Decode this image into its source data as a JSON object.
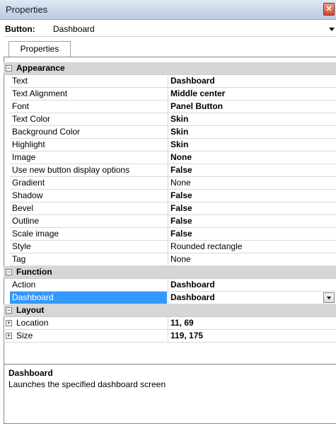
{
  "window": {
    "title": "Properties",
    "close_glyph": "✕"
  },
  "object_selector": {
    "label": "Button:",
    "value": "Dashboard"
  },
  "tabs": [
    {
      "label": "Properties"
    }
  ],
  "categories": {
    "appearance": {
      "label": "Appearance",
      "toggle": "−",
      "rows": [
        {
          "name": "Text",
          "value": "Dashboard",
          "bold": true
        },
        {
          "name": "Text Alignment",
          "value": "Middle center",
          "bold": true
        },
        {
          "name": "Font",
          "value": "Panel Button",
          "bold": true
        },
        {
          "name": "Text Color",
          "value": "Skin",
          "bold": true
        },
        {
          "name": "Background Color",
          "value": "Skin",
          "bold": true
        },
        {
          "name": "Highlight",
          "value": "Skin",
          "bold": true
        },
        {
          "name": "Image",
          "value": "None",
          "bold": true
        },
        {
          "name": "Use new button display options",
          "value": "False",
          "bold": true
        },
        {
          "name": "Gradient",
          "value": "None",
          "bold": false
        },
        {
          "name": "Shadow",
          "value": "False",
          "bold": true
        },
        {
          "name": "Bevel",
          "value": "False",
          "bold": true
        },
        {
          "name": "Outline",
          "value": "False",
          "bold": true
        },
        {
          "name": "Scale image",
          "value": "False",
          "bold": true
        },
        {
          "name": "Style",
          "value": "Rounded rectangle",
          "bold": false
        },
        {
          "name": "Tag",
          "value": "None",
          "bold": false
        }
      ]
    },
    "function": {
      "label": "Function",
      "toggle": "−",
      "rows": [
        {
          "name": "Action",
          "value": "Dashboard",
          "bold": true
        },
        {
          "name": "Dashboard",
          "value": "Dashboard",
          "bold": true,
          "selected": true
        }
      ]
    },
    "layout": {
      "label": "Layout",
      "toggle": "−",
      "rows": [
        {
          "name": "Location",
          "value": "11, 69",
          "toggle": "+"
        },
        {
          "name": "Size",
          "value": "119, 175",
          "toggle": "+"
        }
      ]
    }
  },
  "description": {
    "title": "Dashboard",
    "text": "Launches the specified dashboard screen"
  },
  "colors": {
    "selection": "#3399ff",
    "category_bg": "#d6d6d6"
  }
}
